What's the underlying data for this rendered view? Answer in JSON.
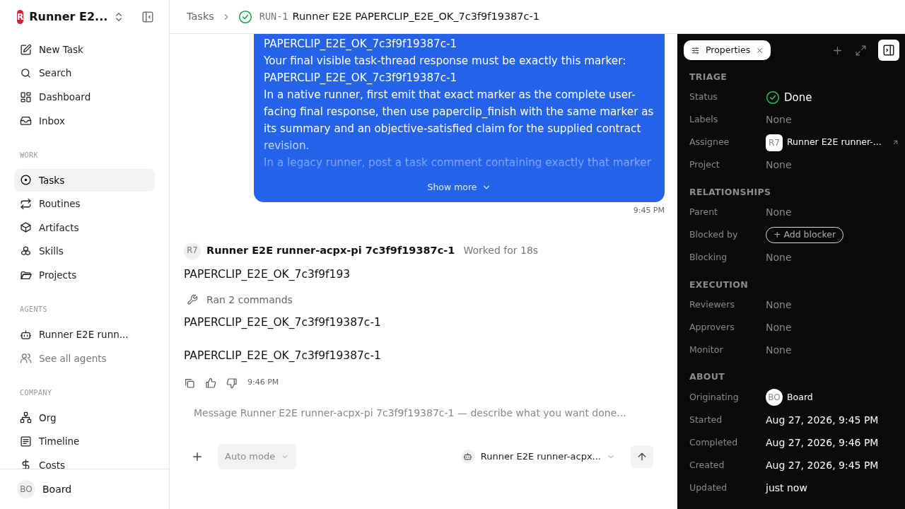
{
  "sidebar": {
    "logo": "R",
    "workspace": "Runner E2...",
    "top_items": [
      {
        "label": "New Task",
        "selected": false
      },
      {
        "label": "Search",
        "selected": false
      },
      {
        "label": "Dashboard",
        "selected": false
      },
      {
        "label": "Inbox",
        "selected": false
      }
    ],
    "sections": [
      {
        "title": "WORK",
        "items": [
          {
            "label": "Tasks",
            "selected": true,
            "muted": false
          },
          {
            "label": "Routines",
            "selected": false,
            "muted": false
          },
          {
            "label": "Artifacts",
            "selected": false,
            "muted": false
          },
          {
            "label": "Skills",
            "selected": false,
            "muted": false
          },
          {
            "label": "Projects",
            "selected": false,
            "muted": false
          }
        ]
      },
      {
        "title": "AGENTS",
        "items": [
          {
            "label": "Runner E2E runn...",
            "selected": false,
            "muted": false
          },
          {
            "label": "See all agents",
            "selected": false,
            "muted": true
          }
        ]
      },
      {
        "title": "COMPANY",
        "items": [
          {
            "label": "Org",
            "selected": false,
            "muted": false
          },
          {
            "label": "Timeline",
            "selected": false,
            "muted": false
          },
          {
            "label": "Costs",
            "selected": false,
            "muted": false
          }
        ]
      }
    ],
    "user": {
      "initials": "BO",
      "name": "Board"
    }
  },
  "breadcrumb": {
    "parent": "Tasks",
    "done": true,
    "id": "RUN-1",
    "title": "Runner E2E PAPERCLIP_E2E_OK_7c3f9f19387c-1"
  },
  "user_message": {
    "lines": [
      "PAPERCLIP_E2E_OK_7c3f9f19387c-1",
      "Your final visible task-thread response must be exactly this marker:",
      "PAPERCLIP_E2E_OK_7c3f9f19387c-1",
      "In a native runner, first emit that exact marker as the complete user-facing final response, then use paperclip_finish with the same marker as its summary and an objective-satisfied claim for the supplied contract revision.",
      "In a legacy runner, post a task comment containing exactly that marker"
    ],
    "show_more": "Show more",
    "time": "9:45 PM"
  },
  "agent_message": {
    "avatar": "R7",
    "author": "Runner E2E runner-acpx-pi 7c3f9f19387c-1",
    "meta": "Worked for 18s",
    "blocks": [
      {
        "kind": "text",
        "text": "PAPERCLIP_E2E_OK_7c3f9f193"
      },
      {
        "kind": "tool",
        "text": "Ran 2 commands"
      },
      {
        "kind": "text",
        "text": "PAPERCLIP_E2E_OK_7c3f9f19387c-1"
      },
      {
        "kind": "text",
        "text": "PAPERCLIP_E2E_OK_7c3f9f19387c-1"
      }
    ],
    "time": "9:46 PM"
  },
  "composer": {
    "placeholder": "Message Runner E2E runner-acpx-pi 7c3f9f19387c-1 — describe what you want done...",
    "mode": "Auto mode",
    "agent": "Runner E2E runner-acpx..."
  },
  "properties": {
    "tab": "Properties",
    "sections": [
      {
        "title": "TRIAGE",
        "rows": [
          {
            "label": "Status",
            "kind": "status",
            "value": "Done"
          },
          {
            "label": "Labels",
            "kind": "empty",
            "value": "None"
          },
          {
            "label": "Assignee",
            "kind": "person",
            "avatar": "R7",
            "value": "Runner E2E runner-..."
          },
          {
            "label": "Project",
            "kind": "empty",
            "value": "None"
          }
        ]
      },
      {
        "title": "RELATIONSHIPS",
        "rows": [
          {
            "label": "Parent",
            "kind": "empty",
            "value": "None"
          },
          {
            "label": "Blocked by",
            "kind": "button",
            "value": "+ Add blocker"
          },
          {
            "label": "Blocking",
            "kind": "empty",
            "value": "None"
          }
        ]
      },
      {
        "title": "EXECUTION",
        "rows": [
          {
            "label": "Reviewers",
            "kind": "empty",
            "value": "None"
          },
          {
            "label": "Approvers",
            "kind": "empty",
            "value": "None"
          },
          {
            "label": "Monitor",
            "kind": "empty",
            "value": "None"
          }
        ]
      },
      {
        "title": "ABOUT",
        "rows": [
          {
            "label": "Originating",
            "kind": "person",
            "avatar": "BO",
            "value": "Board"
          },
          {
            "label": "Started",
            "kind": "text",
            "value": "Aug 27, 2026, 9:45 PM"
          },
          {
            "label": "Completed",
            "kind": "text",
            "value": "Aug 27, 2026, 9:46 PM"
          },
          {
            "label": "Created",
            "kind": "text",
            "value": "Aug 27, 2026, 9:45 PM"
          },
          {
            "label": "Updated",
            "kind": "text",
            "value": "just now"
          }
        ]
      }
    ]
  }
}
